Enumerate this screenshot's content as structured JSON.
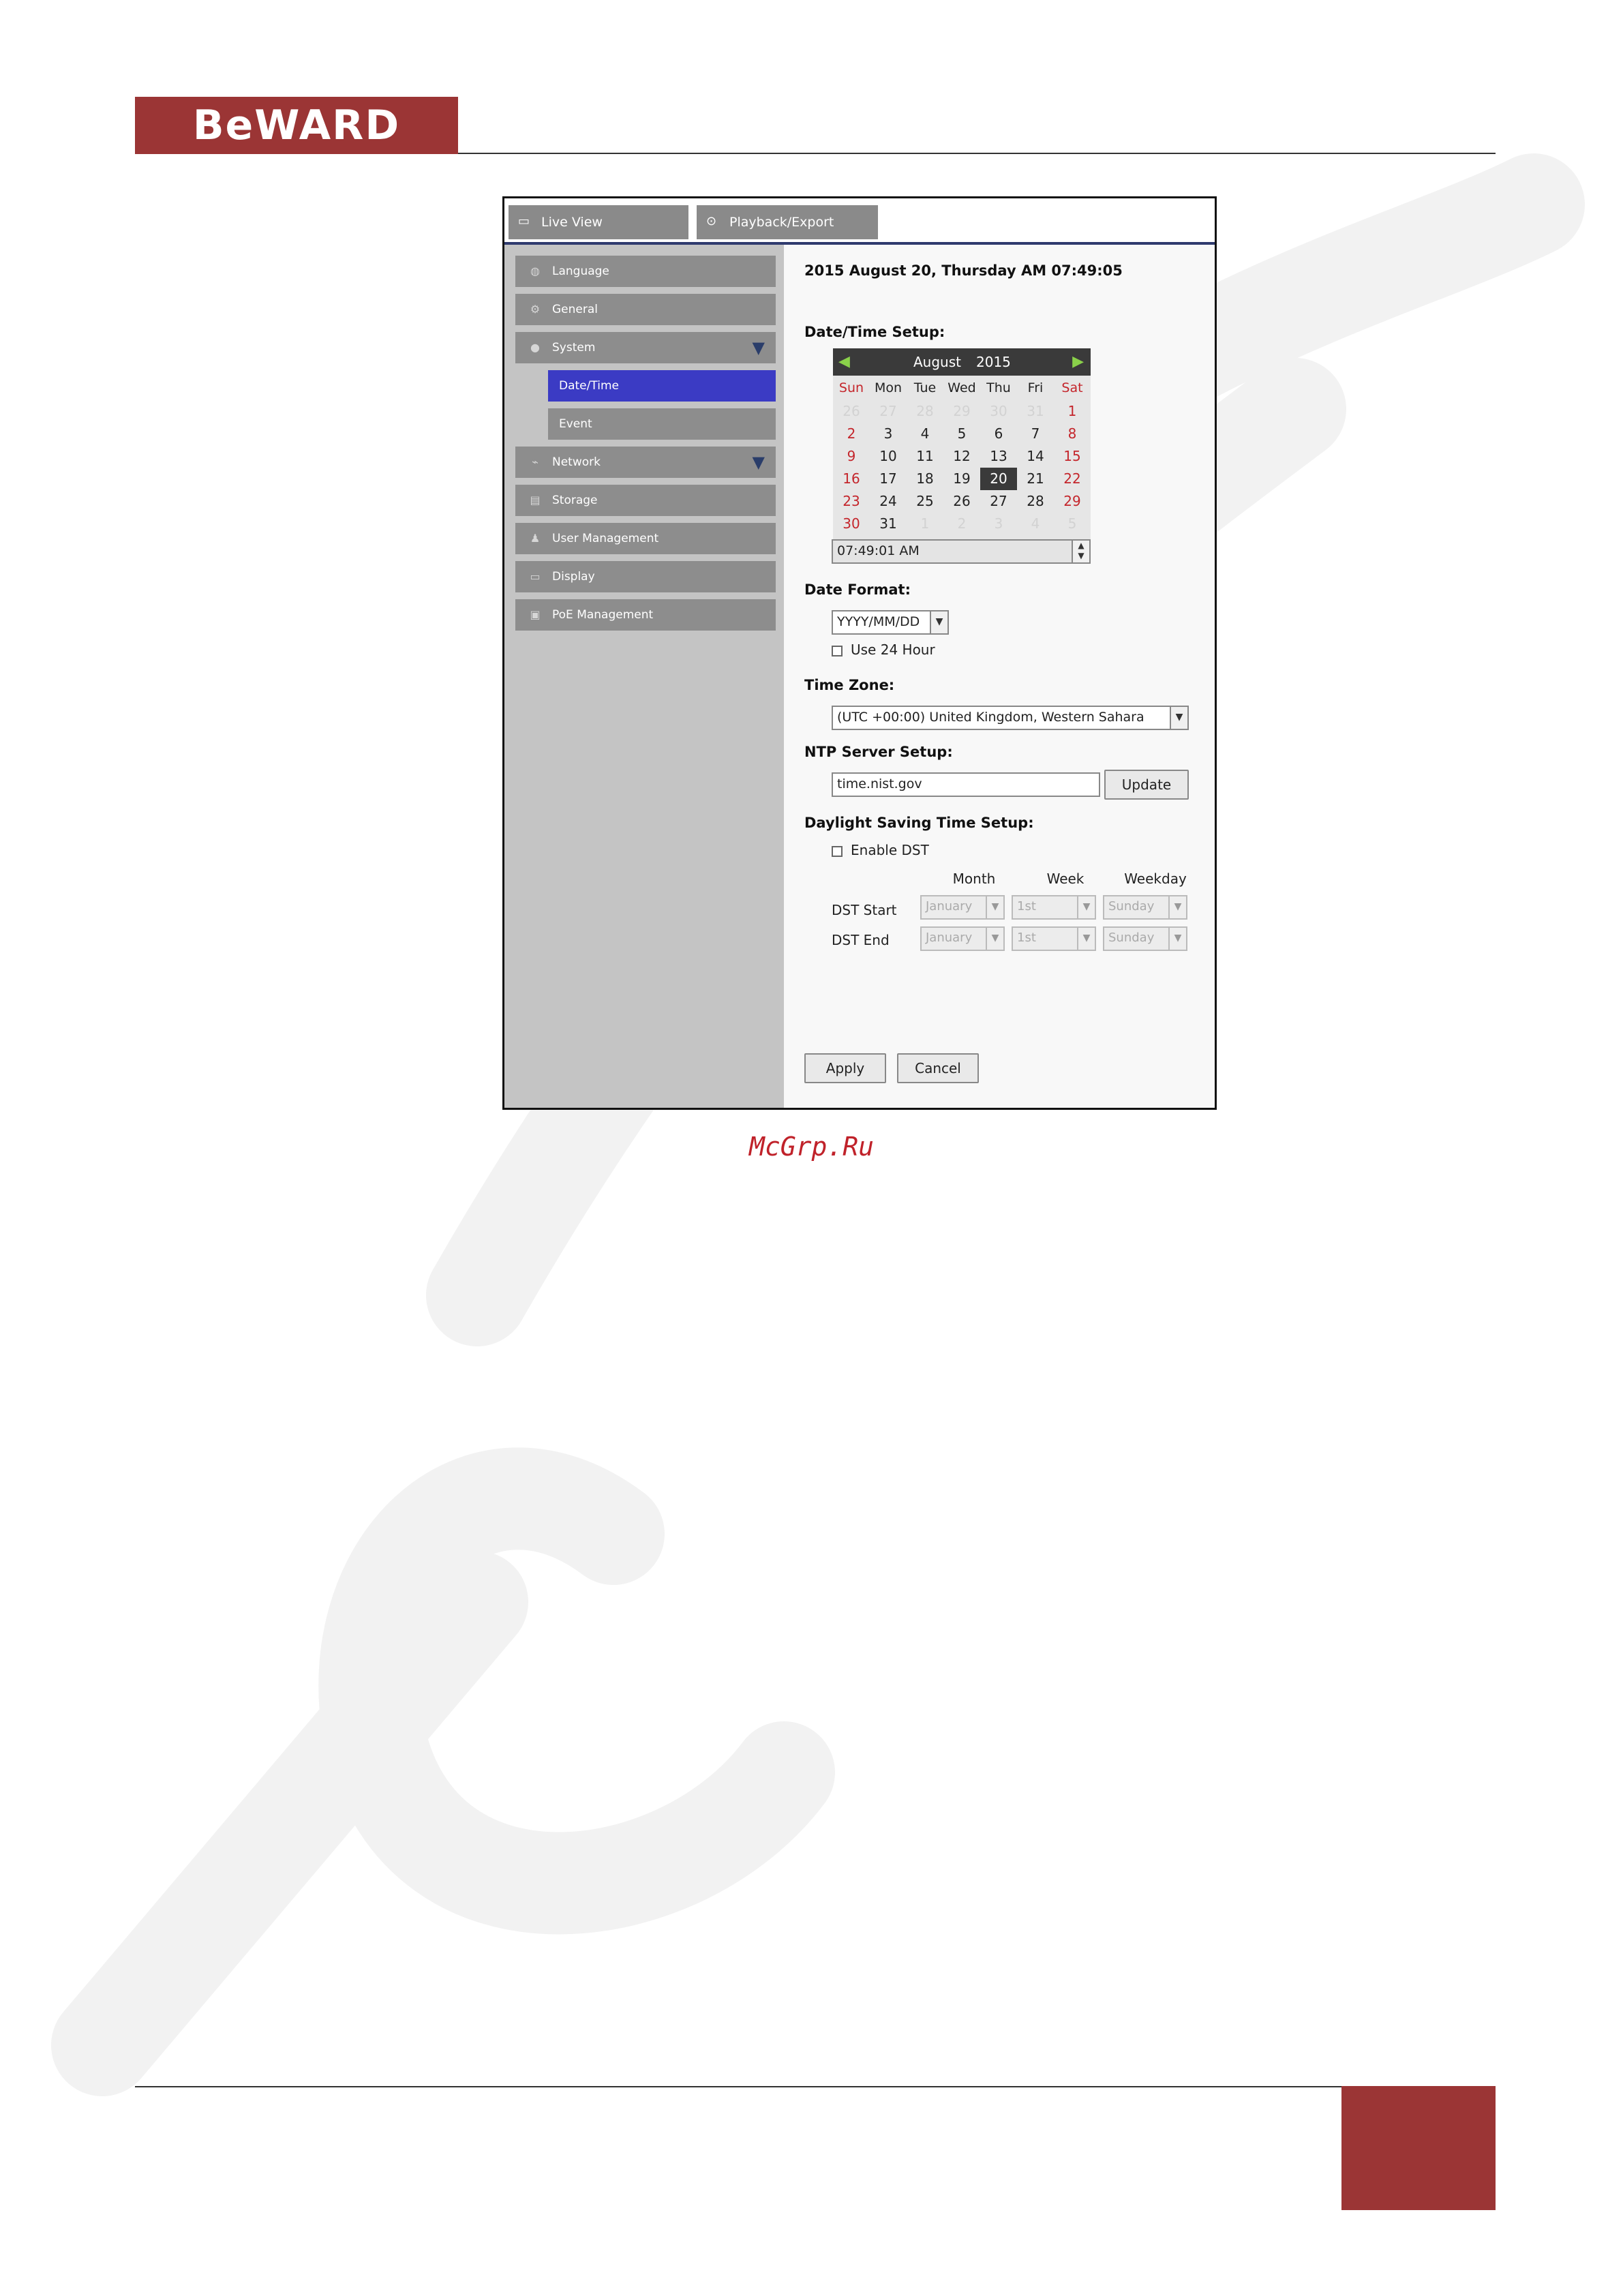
{
  "page": {
    "logo": "BeWARD",
    "site_caption": "McGrp.Ru",
    "brand_color": "#9b3535"
  },
  "tabs": [
    {
      "label": "Live View",
      "icon": "monitor-icon"
    },
    {
      "label": "Playback/Export",
      "icon": "play-circle-icon"
    }
  ],
  "sidebar": {
    "items": [
      {
        "label": "Language",
        "icon": "globe-icon"
      },
      {
        "label": "General",
        "icon": "wrench-icon"
      },
      {
        "label": "System",
        "icon": "info-icon",
        "expanded": true
      },
      {
        "label": "Network",
        "icon": "network-icon",
        "expanded": true
      },
      {
        "label": "Storage",
        "icon": "storage-icon"
      },
      {
        "label": "User Management",
        "icon": "user-icon"
      },
      {
        "label": "Display",
        "icon": "display-icon"
      },
      {
        "label": "PoE Management",
        "icon": "poe-icon"
      }
    ],
    "subitems": [
      {
        "label": "Date/Time",
        "active": true
      },
      {
        "label": "Event",
        "active": false
      }
    ]
  },
  "content": {
    "current_datetime": "2015 August 20, Thursday AM 07:49:05",
    "datetime_setup_label": "Date/Time Setup:",
    "calendar": {
      "month": "August",
      "year": "2015",
      "weekdays": [
        "Sun",
        "Mon",
        "Tue",
        "Wed",
        "Thu",
        "Fri",
        "Sat"
      ],
      "weeks": [
        [
          "26",
          "27",
          "28",
          "29",
          "30",
          "31",
          "1"
        ],
        [
          "2",
          "3",
          "4",
          "5",
          "6",
          "7",
          "8"
        ],
        [
          "9",
          "10",
          "11",
          "12",
          "13",
          "14",
          "15"
        ],
        [
          "16",
          "17",
          "18",
          "19",
          "20",
          "21",
          "22"
        ],
        [
          "23",
          "24",
          "25",
          "26",
          "27",
          "28",
          "29"
        ],
        [
          "30",
          "31",
          "1",
          "2",
          "3",
          "4",
          "5"
        ]
      ],
      "selected_day": "20"
    },
    "time_value": "07:49:01 AM",
    "date_format_label": "Date Format:",
    "date_format_value": "YYYY/MM/DD",
    "use24_label": "Use 24 Hour",
    "timezone_label": "Time Zone:",
    "timezone_value": "(UTC +00:00) United Kingdom, Western Sahara",
    "ntp_label": "NTP Server Setup:",
    "ntp_value": "time.nist.gov",
    "update_label": "Update",
    "dst_label": "Daylight Saving Time Setup:",
    "enable_dst_label": "Enable DST",
    "dst_cols": [
      "Month",
      "Week",
      "Weekday"
    ],
    "dst_start_label": "DST Start",
    "dst_end_label": "DST End",
    "dst_start": [
      "January",
      "1st",
      "Sunday"
    ],
    "dst_end": [
      "January",
      "1st",
      "Sunday"
    ],
    "apply_label": "Apply",
    "cancel_label": "Cancel"
  }
}
